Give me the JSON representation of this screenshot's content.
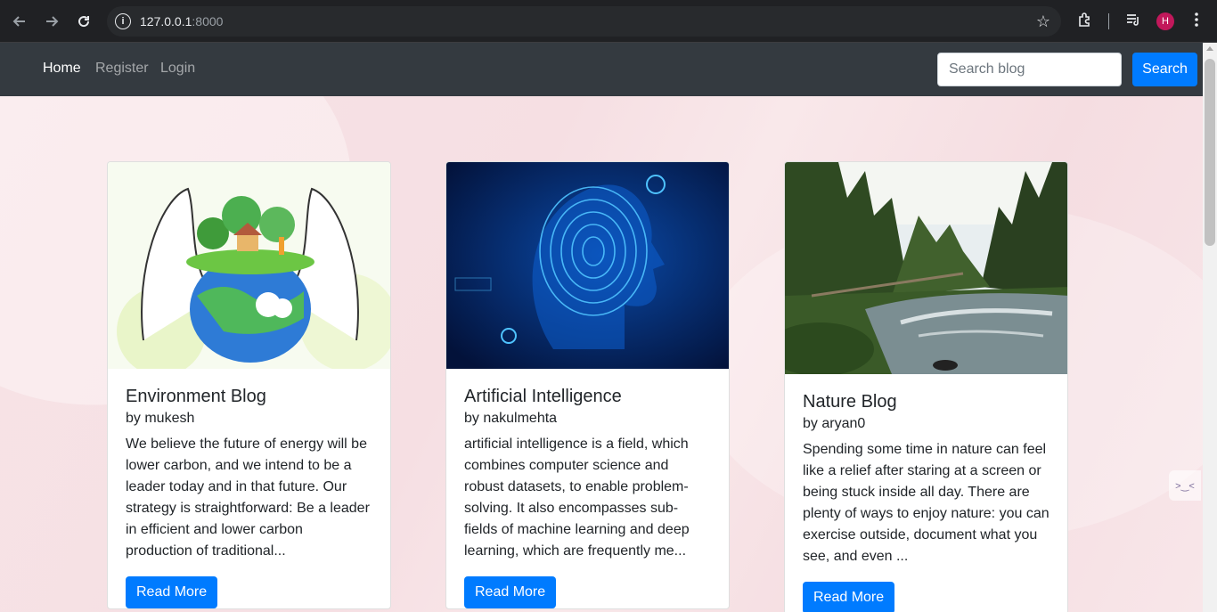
{
  "browser": {
    "url_host": "127.0.0.1",
    "url_port": ":8000",
    "avatar_letter": "H"
  },
  "nav": {
    "links": [
      {
        "label": "Home"
      },
      {
        "label": "Register"
      },
      {
        "label": "Login"
      }
    ],
    "search_placeholder": "Search blog",
    "search_button": "Search"
  },
  "cards": [
    {
      "title": "Environment Blog",
      "author": "by mukesh",
      "excerpt": "We believe the future of energy will be lower carbon, and we intend to be a leader today and in that future. Our strategy is straightforward: Be a leader in efficient and lower carbon production of traditional...",
      "button": "Read More",
      "image": "globe-in-hands-image"
    },
    {
      "title": "Artificial Intelligence",
      "author": "by nakulmehta",
      "excerpt": "artificial intelligence is a field, which combines computer science and robust datasets, to enable problem-solving. It also encompasses sub-fields of machine learning and deep learning, which are frequently me...",
      "button": "Read More",
      "image": "fingerprint-head-image"
    },
    {
      "title": "Nature Blog",
      "author": "by aryan0",
      "excerpt": "Spending some time in nature can feel like a relief after staring at a screen or being stuck inside all day. There are plenty of ways to enjoy nature: you can exercise outside, document what you see, and even ...",
      "button": "Read More",
      "image": "forest-river-image"
    }
  ],
  "colors": {
    "navbar_bg": "#343a40",
    "primary": "#007bff",
    "page_bg": "#f7e3e6"
  }
}
